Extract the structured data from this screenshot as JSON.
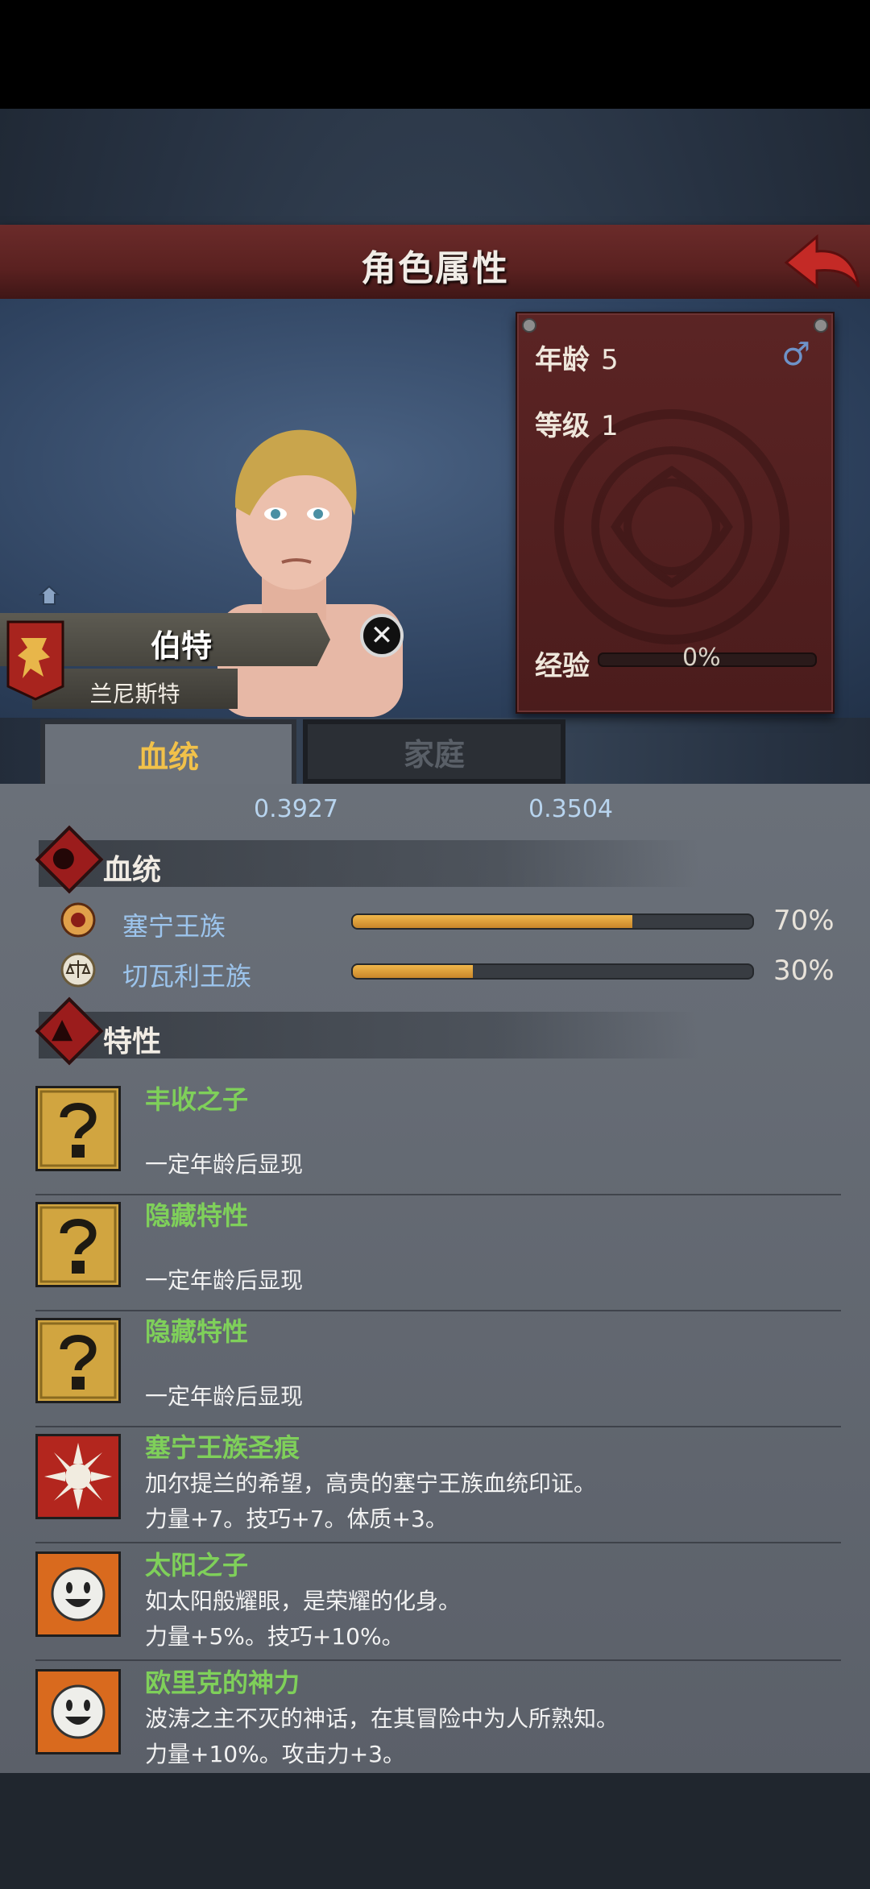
{
  "header": {
    "title": "角色属性",
    "back_icon": "red-back-arrow-icon"
  },
  "character": {
    "name": "伯特",
    "house": "兰尼斯特",
    "age_label": "年龄",
    "age": "5",
    "level_label": "等级",
    "level": "1",
    "gender_symbol": "♂",
    "exp_label": "经验",
    "exp_value": "0%",
    "exp_progress": 0,
    "close_glyph": "✕"
  },
  "tabs": [
    {
      "label": "血统",
      "active": true
    },
    {
      "label": "家庭",
      "active": false
    }
  ],
  "stats": {
    "left": "0.3927",
    "right": "0.3504"
  },
  "bloodline": {
    "title": "血统",
    "items": [
      {
        "name": "塞宁王族",
        "percent": "70%",
        "progress": 0.7
      },
      {
        "name": "切瓦利王族",
        "percent": "30%",
        "progress": 0.3
      }
    ]
  },
  "traits": {
    "title": "特性",
    "items": [
      {
        "name": "丰收之子",
        "desc": "一定年龄后显现",
        "effect": "",
        "icon": "question-mark-icon"
      },
      {
        "name": "隐藏特性",
        "desc": "一定年龄后显现",
        "effect": "",
        "icon": "question-mark-icon"
      },
      {
        "name": "隐藏特性",
        "desc": "一定年龄后显现",
        "effect": "",
        "icon": "question-mark-icon"
      },
      {
        "name": "塞宁王族圣痕",
        "desc": "加尔提兰的希望，高贵的塞宁王族血统印证。",
        "effect": "力量+7。技巧+7。体质+3。",
        "icon": "sun-sigil-icon"
      },
      {
        "name": "太阳之子",
        "desc": "如太阳般耀眼，是荣耀的化身。",
        "effect": "力量+5%。技巧+10%。",
        "icon": "smiling-sun-icon"
      },
      {
        "name": "欧里克的神力",
        "desc": "波涛之主不灭的神话，在其冒险中为人所熟知。",
        "effect": "力量+10%。攻击力+3。",
        "icon": "smiling-sun-icon"
      }
    ]
  }
}
